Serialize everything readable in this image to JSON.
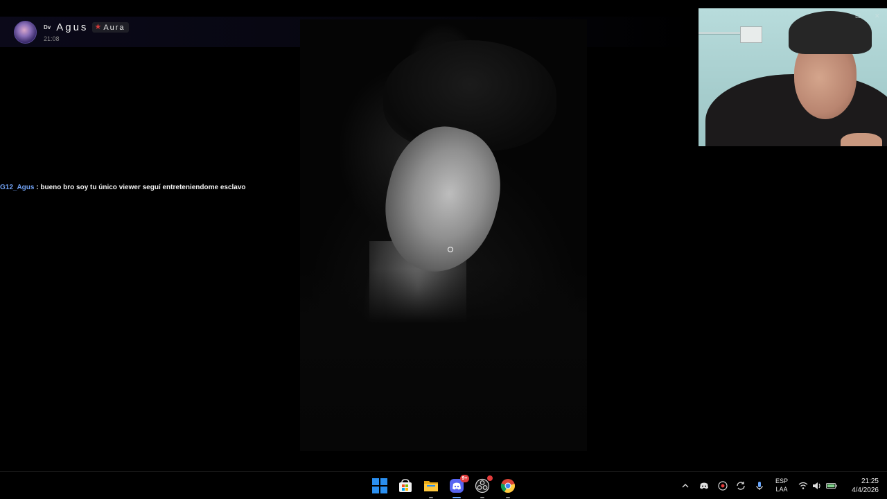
{
  "message": {
    "author_prefix": "Dv",
    "author_name": "Agus",
    "role_badge": "Aura",
    "timestamp": "21:08"
  },
  "chat": {
    "username": "G12_Agus",
    "separator": " : ",
    "text": "bueno bro soy tu único viewer seguí entreteniendome esclavo"
  },
  "taskbar": {
    "apps": [
      {
        "name": "start",
        "icon": "windows-start-icon"
      },
      {
        "name": "store",
        "icon": "microsoft-store-icon"
      },
      {
        "name": "file-explorer",
        "icon": "folder-icon"
      },
      {
        "name": "discord",
        "icon": "discord-icon",
        "badge": "9+"
      },
      {
        "name": "obs",
        "icon": "obs-icon"
      },
      {
        "name": "chrome",
        "icon": "chrome-icon"
      }
    ],
    "tray": {
      "language_line1": "ESP",
      "language_line2": "LAA",
      "time": "21:25",
      "date": "4/4/2026"
    }
  },
  "colors": {
    "chat_username": "#6f9ff0",
    "accent_blue": "#2a8ff0",
    "badge_red": "#e23c3c"
  }
}
